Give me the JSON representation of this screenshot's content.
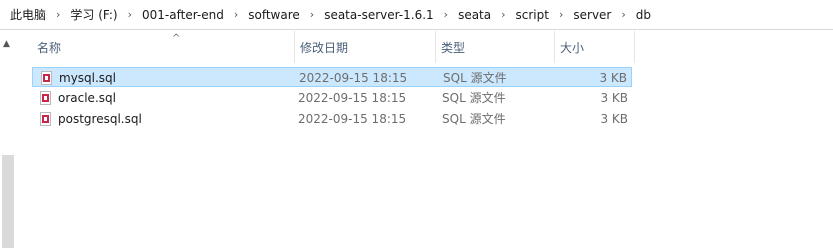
{
  "breadcrumb": [
    "此电脑",
    "学习 (F:)",
    "001-after-end",
    "software",
    "seata-server-1.6.1",
    "seata",
    "script",
    "server",
    "db"
  ],
  "columns": {
    "name": "名称",
    "date": "修改日期",
    "type": "类型",
    "size": "大小"
  },
  "files": [
    {
      "name": "mysql.sql",
      "date": "2022-09-15 18:15",
      "type": "SQL 源文件",
      "size": "3 KB",
      "selected": true
    },
    {
      "name": "oracle.sql",
      "date": "2022-09-15 18:15",
      "type": "SQL 源文件",
      "size": "3 KB",
      "selected": false
    },
    {
      "name": "postgresql.sql",
      "date": "2022-09-15 18:15",
      "type": "SQL 源文件",
      "size": "3 KB",
      "selected": false
    }
  ],
  "icons": {
    "separator": "chevron-right-icon",
    "file": "sql-file-icon",
    "sort": "sort-up-icon",
    "scroll_up": "scroll-up-icon"
  },
  "colors": {
    "selection_bg": "#cce8ff",
    "selection_border": "#99d1ff",
    "header_text": "#4c607a",
    "file_icon": "#c8264b"
  }
}
